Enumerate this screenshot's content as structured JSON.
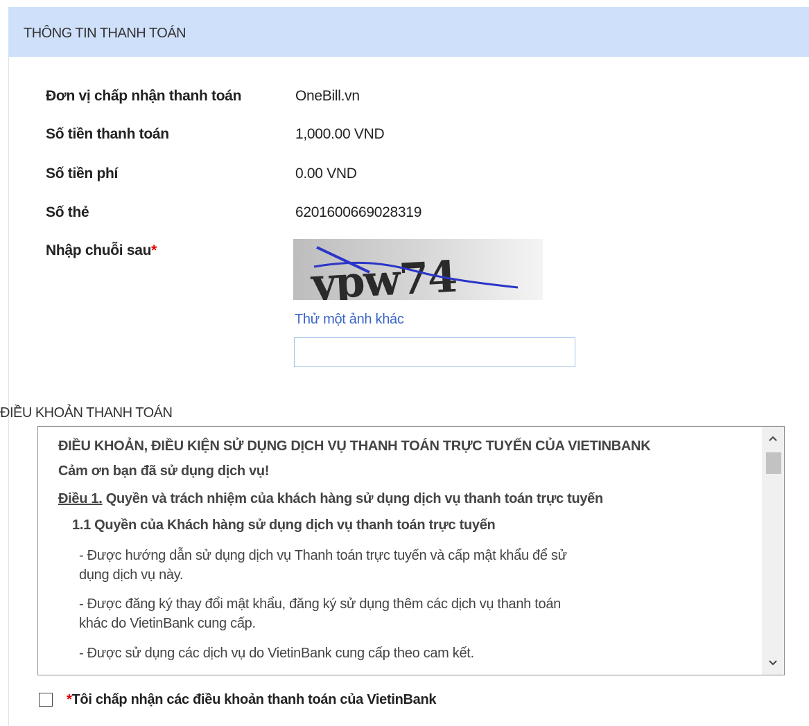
{
  "header": {
    "title": "THÔNG TIN THANH TOÁN"
  },
  "info": {
    "merchant_label": "Đơn vị chấp nhận thanh toán",
    "merchant_value": "OneBill.vn",
    "amount_label": "Số tiền thanh toán",
    "amount_value": "1,000.00 VND",
    "fee_label": "Số tiền phí",
    "fee_value": "0.00 VND",
    "card_label": "Số thẻ",
    "card_value": "6201600669028319",
    "captcha_label": "Nhập chuỗi sau",
    "captcha_required": "*"
  },
  "captcha": {
    "text": "ypw74",
    "retry_link": "Thử một ảnh khác",
    "input_value": ""
  },
  "terms": {
    "section_title": "ĐIỀU KHOẢN THANH TOÁN",
    "heading": "ĐIỀU KHOẢN, ĐIỀU KIỆN SỬ DỤNG DỊCH VỤ THANH TOÁN TRỰC TUYẾN CỦA VIETINBANK",
    "thanks": "Cảm ơn bạn đã sử dụng dịch vụ!",
    "article_prefix": "Điều 1.",
    "article_title": " Quyền và trách nhiệm của khách hàng sử dụng dịch vụ thanh toán trực tuyến",
    "sub_heading": "1.1 Quyền của Khách hàng sử dụng dịch vụ thanh toán trực tuyến",
    "item1_line1": "- Được hướng dẫn sử dụng dịch vụ Thanh toán trực tuyến và cấp mật khẩu để sử",
    "item1_line2": "dụng dịch vụ này.",
    "item2_line1": "- Được đăng ký thay đổi mật khẩu, đăng ký sử dụng thêm các dịch vụ thanh toán",
    "item2_line2": "khác do VietinBank cung cấp.",
    "item3_line1": "- Được sử dụng các dịch vụ do VietinBank cung cấp theo cam kết."
  },
  "accept": {
    "required": "*",
    "label": "Tôi chấp nhận các điều khoản thanh toán của VietinBank",
    "checked": false
  },
  "colors": {
    "header_bg": "#cfe0fb",
    "link": "#3a64c6",
    "required": "#e00000",
    "input_border": "#9ec3e8"
  }
}
